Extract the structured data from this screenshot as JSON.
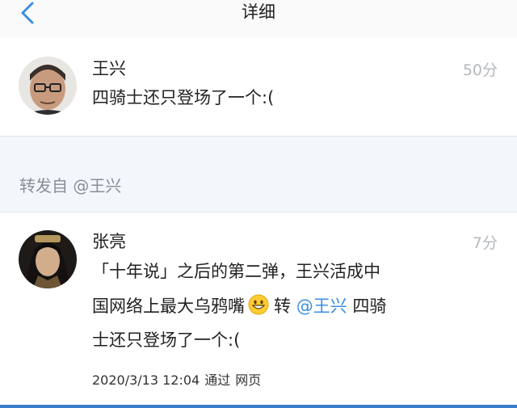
{
  "nav": {
    "title": "详细",
    "back_icon": "chevron-left-icon"
  },
  "comment": {
    "user": "王兴",
    "time": "50分",
    "text": "四骑士还只登场了一个:("
  },
  "forward": {
    "label": "转发自 @王兴"
  },
  "post": {
    "user": "张亮",
    "time": "7分",
    "line1": "「十年说」之后的第二弹，王兴活成中",
    "line2_start": "国网络上最大乌鸦嘴",
    "emoji": "grinning-face",
    "repost_word": "转 ",
    "mention": "@王兴",
    "line2_end": " 四骑",
    "line3": "士还只登场了一个:(",
    "date": "2020/3/13 12:04",
    "via_label": "通过",
    "source": "网页"
  },
  "colors": {
    "accent": "#3b8ee0",
    "muted": "#888e95",
    "time": "#b5b9bf"
  }
}
